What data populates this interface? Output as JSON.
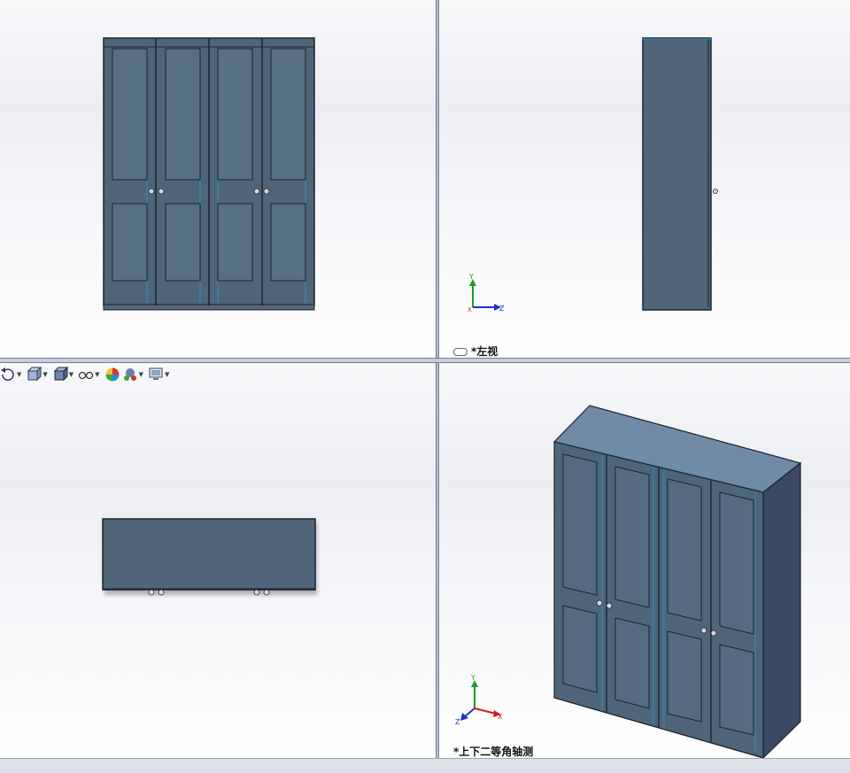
{
  "viewports": {
    "top_left": {
      "name": "front-view"
    },
    "top_right": {
      "name": "left-view",
      "label": "*左视"
    },
    "bottom_left": {
      "name": "top-view"
    },
    "bottom_right": {
      "name": "dimetric-view",
      "label": "*上下二等角轴测"
    }
  },
  "triad": {
    "x": "X",
    "y": "Y",
    "z": "Z"
  },
  "toolbar": {
    "items": [
      {
        "icon": "rotate-view-icon"
      },
      {
        "icon": "section-view-icon"
      },
      {
        "icon": "display-style-icon"
      },
      {
        "icon": "hide-show-items-icon"
      },
      {
        "icon": "edit-appearance-icon"
      },
      {
        "icon": "apply-scene-icon"
      },
      {
        "icon": "view-settings-icon"
      }
    ]
  },
  "colors": {
    "body": "#4f6578",
    "panel": "#566d80",
    "top_face": "#6f8ba6",
    "side_face": "#3b4a62",
    "edge": "#1a2430",
    "highlight": "#2f8fc0",
    "axis_x": "#d42020",
    "axis_y": "#1f9a2a",
    "axis_z": "#2030c8"
  }
}
